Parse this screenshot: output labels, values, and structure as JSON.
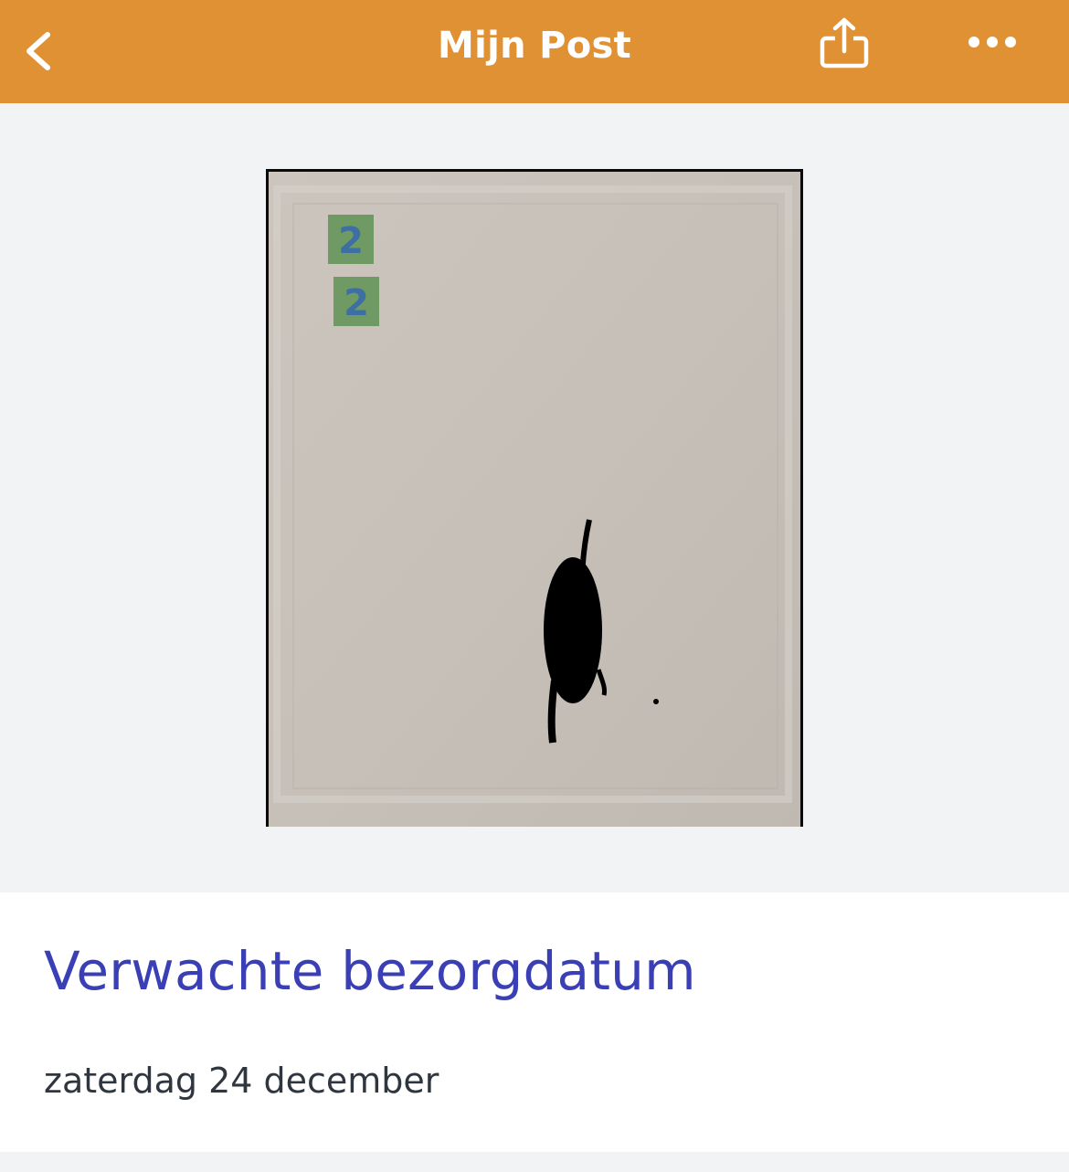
{
  "header": {
    "title": "Mijn Post",
    "back_icon": "chevron-left-icon",
    "share_icon": "share-icon",
    "more_icon": "more-horizontal-icon",
    "background_color": "#e09134"
  },
  "mail_item": {
    "stamp_value": "2"
  },
  "delivery": {
    "label": "Verwachte bezorgdatum",
    "date": "zaterdag 24 december",
    "label_color": "#3a3fb5"
  }
}
